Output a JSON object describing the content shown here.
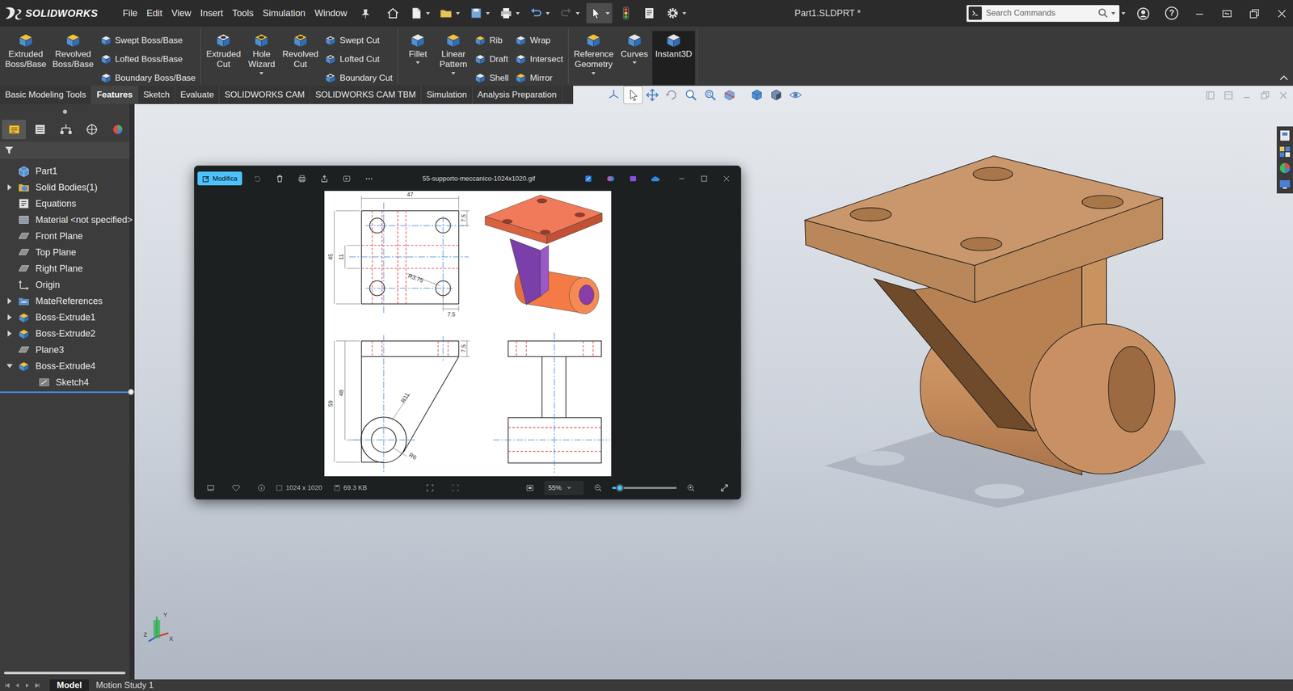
{
  "app": {
    "brand": "SOLIDWORKS"
  },
  "menu": [
    "File",
    "Edit",
    "View",
    "Insert",
    "Tools",
    "Simulation",
    "Window"
  ],
  "quick_access": [
    {
      "kind": "home",
      "dropdown": false,
      "disabled": false,
      "selected": false
    },
    {
      "kind": "new",
      "dropdown": true,
      "disabled": false,
      "selected": false
    },
    {
      "kind": "open",
      "dropdown": true,
      "disabled": false,
      "selected": false
    },
    {
      "kind": "save",
      "dropdown": true,
      "disabled": false,
      "selected": false
    },
    {
      "kind": "print",
      "dropdown": true,
      "disabled": false,
      "selected": false
    },
    {
      "kind": "undo",
      "dropdown": true,
      "disabled": false,
      "selected": false
    },
    {
      "kind": "redo",
      "dropdown": true,
      "disabled": true,
      "selected": false
    },
    {
      "kind": "select",
      "dropdown": true,
      "disabled": false,
      "selected": true
    },
    {
      "kind": "rebuild",
      "dropdown": false,
      "disabled": false,
      "selected": false
    },
    {
      "kind": "properties",
      "dropdown": false,
      "disabled": false,
      "selected": false
    },
    {
      "kind": "options",
      "dropdown": true,
      "disabled": false,
      "selected": false
    }
  ],
  "window": {
    "title": "Part1.SLDPRT *"
  },
  "search": {
    "placeholder": "Search Commands"
  },
  "title_controls": {
    "help": "?"
  },
  "ribbon": {
    "groups": [
      {
        "columns": [
          {
            "kind": "large",
            "lines": [
              "Extruded",
              "Boss/Base"
            ],
            "dropdown": false,
            "selected": false
          },
          {
            "kind": "large",
            "lines": [
              "Revolved",
              "Boss/Base"
            ],
            "dropdown": false,
            "selected": false
          },
          {
            "kind": "stack",
            "items": [
              "Swept Boss/Base",
              "Lofted Boss/Base",
              "Boundary Boss/Base"
            ]
          }
        ]
      },
      {
        "columns": [
          {
            "kind": "large",
            "lines": [
              "Extruded",
              "Cut"
            ],
            "dropdown": false,
            "selected": false
          },
          {
            "kind": "large",
            "lines": [
              "Hole",
              "Wizard"
            ],
            "dropdown": true,
            "selected": false
          },
          {
            "kind": "large",
            "lines": [
              "Revolved",
              "Cut"
            ],
            "dropdown": false,
            "selected": false
          },
          {
            "kind": "stack",
            "items": [
              "Swept Cut",
              "Lofted Cut",
              "Boundary Cut"
            ]
          }
        ]
      },
      {
        "columns": [
          {
            "kind": "large",
            "lines": [
              "Fillet"
            ],
            "dropdown": true,
            "selected": false
          },
          {
            "kind": "large",
            "lines": [
              "Linear",
              "Pattern"
            ],
            "dropdown": true,
            "selected": false
          },
          {
            "kind": "stack",
            "items": [
              "Rib",
              "Draft",
              "Shell"
            ]
          },
          {
            "kind": "stack",
            "items": [
              "Wrap",
              "Intersect",
              "Mirror"
            ]
          }
        ]
      },
      {
        "columns": [
          {
            "kind": "large",
            "lines": [
              "Reference",
              "Geometry"
            ],
            "dropdown": true,
            "selected": false
          },
          {
            "kind": "large",
            "lines": [
              "Curves"
            ],
            "dropdown": true,
            "selected": false
          },
          {
            "kind": "large",
            "lines": [
              "Instant3D"
            ],
            "dropdown": false,
            "selected": true
          }
        ]
      }
    ]
  },
  "tabs": [
    {
      "label": "Basic Modeling Tools",
      "selected": false
    },
    {
      "label": "Features",
      "selected": true
    },
    {
      "label": "Sketch",
      "selected": false
    },
    {
      "label": "Evaluate",
      "selected": false
    },
    {
      "label": "SOLIDWORKS CAM",
      "selected": false
    },
    {
      "label": "SOLIDWORKS CAM TBM",
      "selected": false
    },
    {
      "label": "Simulation",
      "selected": false
    },
    {
      "label": "Analysis Preparation",
      "selected": false
    }
  ],
  "heads_up": [
    {
      "kind": "view-orientation",
      "selected": false
    },
    {
      "kind": "select",
      "selected": true
    },
    {
      "kind": "move",
      "selected": false
    },
    {
      "kind": "rotate",
      "selected": false
    },
    {
      "kind": "zoom-fit",
      "selected": false
    },
    {
      "kind": "zoom-area",
      "selected": false
    },
    {
      "kind": "section",
      "selected": false
    },
    {
      "kind": "view-cube",
      "selected": false
    },
    {
      "kind": "display-style",
      "selected": false
    },
    {
      "kind": "hide-show",
      "selected": false
    }
  ],
  "panel_tabs": [
    {
      "selected": true
    },
    {
      "selected": false
    },
    {
      "selected": false
    },
    {
      "selected": false
    },
    {
      "selected": false
    }
  ],
  "tree": [
    {
      "label": "Part1",
      "kind": "part",
      "level": 0,
      "expandable": false,
      "expanded": false
    },
    {
      "label": "Solid Bodies(1)",
      "kind": "bodies",
      "level": 0,
      "expandable": true,
      "expanded": false
    },
    {
      "label": "Equations",
      "kind": "equations",
      "level": 0,
      "expandable": false,
      "expanded": false
    },
    {
      "label": "Material <not specified>",
      "kind": "material",
      "level": 0,
      "expandable": false,
      "expanded": false
    },
    {
      "label": "Front Plane",
      "kind": "plane",
      "level": 0,
      "expandable": false,
      "expanded": false
    },
    {
      "label": "Top Plane",
      "kind": "plane",
      "level": 0,
      "expandable": false,
      "expanded": false
    },
    {
      "label": "Right Plane",
      "kind": "plane",
      "level": 0,
      "expandable": false,
      "expanded": false
    },
    {
      "label": "Origin",
      "kind": "origin",
      "level": 0,
      "expandable": false,
      "expanded": false
    },
    {
      "label": "MateReferences",
      "kind": "mates",
      "level": 0,
      "expandable": true,
      "expanded": false
    },
    {
      "label": "Boss-Extrude1",
      "kind": "feature",
      "level": 0,
      "expandable": true,
      "expanded": false
    },
    {
      "label": "Boss-Extrude2",
      "kind": "feature",
      "level": 0,
      "expandable": true,
      "expanded": false
    },
    {
      "label": "Plane3",
      "kind": "plane",
      "level": 0,
      "expandable": false,
      "expanded": false
    },
    {
      "label": "Boss-Extrude4",
      "kind": "feature",
      "level": 0,
      "expandable": true,
      "expanded": true
    },
    {
      "label": "Sketch4",
      "kind": "sketch",
      "level": 1,
      "expandable": false,
      "expanded": false
    }
  ],
  "viewer": {
    "edit_button": "Modifica",
    "title": "55-supporto-meccanico-1024x1020.gif",
    "resolution": "1024 x 1020",
    "file_size": "69.3 KB",
    "zoom": "55%",
    "zoom_level": 0.12
  },
  "drawing": {
    "top_view": [
      "47",
      "7.5",
      "45",
      "11",
      "R3.75",
      "7.5"
    ],
    "front_view": [
      "7.5",
      "59",
      "48",
      "R11",
      "R6"
    ]
  },
  "triad": [
    "Y",
    "X",
    "Z"
  ],
  "bottom_tabs": [
    {
      "label": "Model",
      "selected": true
    },
    {
      "label": "Motion Study 1",
      "selected": false
    }
  ]
}
